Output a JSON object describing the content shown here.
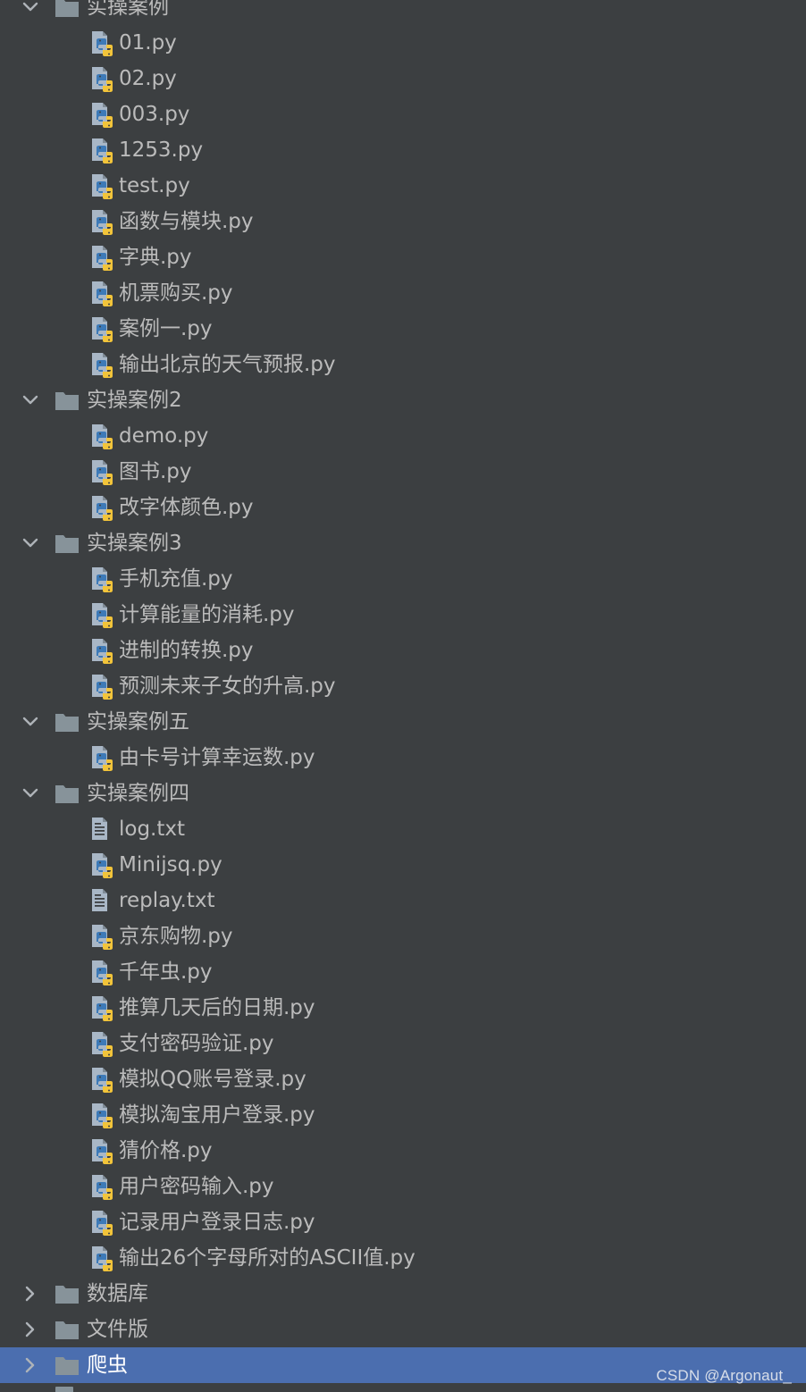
{
  "tree": [
    {
      "type": "folder",
      "label": "实操案例",
      "expanded": true
    },
    {
      "type": "py",
      "label": "01.py"
    },
    {
      "type": "py",
      "label": "02.py"
    },
    {
      "type": "py",
      "label": "003.py"
    },
    {
      "type": "py",
      "label": "1253.py"
    },
    {
      "type": "py",
      "label": "test.py"
    },
    {
      "type": "py",
      "label": "函数与模块.py"
    },
    {
      "type": "py",
      "label": "字典.py"
    },
    {
      "type": "py",
      "label": "机票购买.py"
    },
    {
      "type": "py",
      "label": "案例一.py"
    },
    {
      "type": "py",
      "label": "输出北京的天气预报.py"
    },
    {
      "type": "folder",
      "label": "实操案例2",
      "expanded": true
    },
    {
      "type": "py",
      "label": "demo.py"
    },
    {
      "type": "py",
      "label": "图书.py"
    },
    {
      "type": "py",
      "label": "改字体颜色.py"
    },
    {
      "type": "folder",
      "label": "实操案例3",
      "expanded": true
    },
    {
      "type": "py",
      "label": "手机充值.py"
    },
    {
      "type": "py",
      "label": "计算能量的消耗.py"
    },
    {
      "type": "py",
      "label": "进制的转换.py"
    },
    {
      "type": "py",
      "label": "预测未来子女的升高.py"
    },
    {
      "type": "folder",
      "label": "实操案例五",
      "expanded": true
    },
    {
      "type": "py",
      "label": "由卡号计算幸运数.py"
    },
    {
      "type": "folder",
      "label": "实操案例四",
      "expanded": true
    },
    {
      "type": "txt",
      "label": "log.txt"
    },
    {
      "type": "py",
      "label": "Minijsq.py"
    },
    {
      "type": "txt",
      "label": "replay.txt"
    },
    {
      "type": "py",
      "label": "京东购物.py"
    },
    {
      "type": "py",
      "label": "千年虫.py"
    },
    {
      "type": "py",
      "label": "推算几天后的日期.py"
    },
    {
      "type": "py",
      "label": "支付密码验证.py"
    },
    {
      "type": "py",
      "label": "模拟QQ账号登录.py"
    },
    {
      "type": "py",
      "label": "模拟淘宝用户登录.py"
    },
    {
      "type": "py",
      "label": "猜价格.py"
    },
    {
      "type": "py",
      "label": "用户密码输入.py"
    },
    {
      "type": "py",
      "label": "记录用户登录日志.py"
    },
    {
      "type": "py",
      "label": "输出26个字母所对的ASCII值.py"
    },
    {
      "type": "folder",
      "label": "数据库",
      "expanded": false
    },
    {
      "type": "folder",
      "label": "文件版",
      "expanded": false
    },
    {
      "type": "folder",
      "label": "爬虫",
      "expanded": false,
      "selected": true
    }
  ],
  "watermark": "CSDN @Argonaut_",
  "colors": {
    "background": "#3c3f41",
    "text": "#bbbbbb",
    "selection": "#4b6eaf",
    "folder_icon": "#87939a",
    "python_blue": "#3d7ab8",
    "python_yellow": "#f2c43a"
  }
}
